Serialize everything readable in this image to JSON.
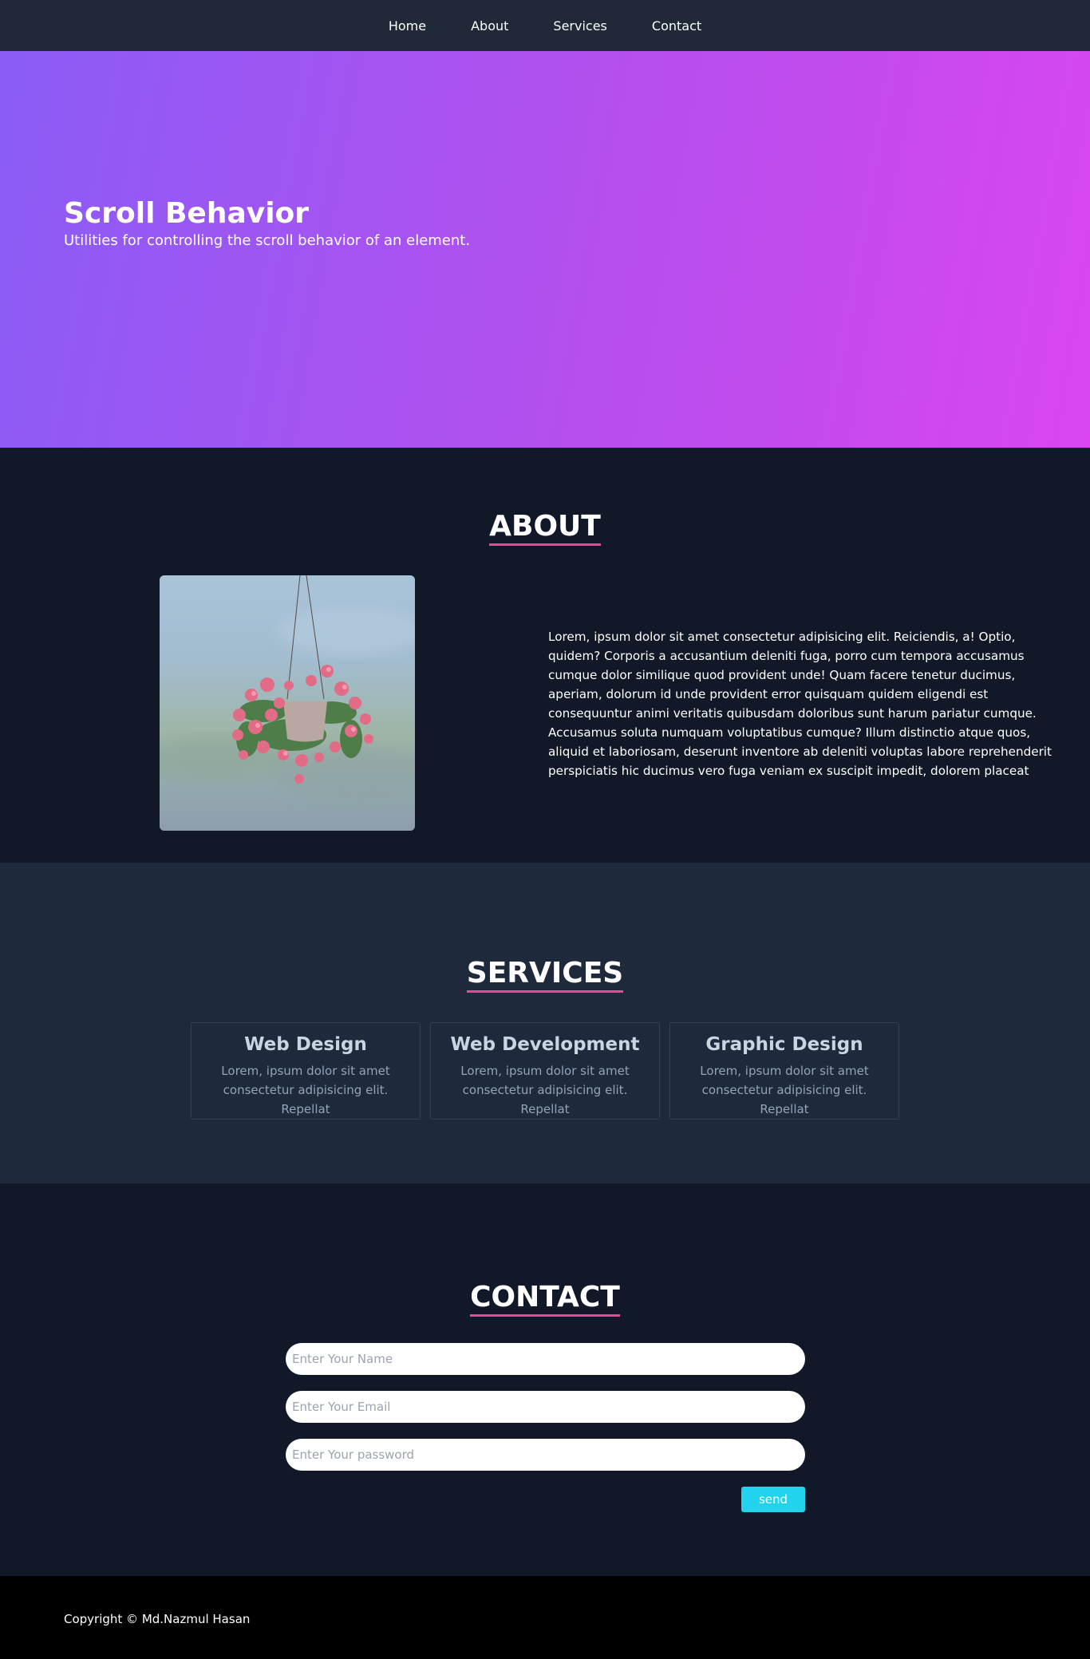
{
  "nav": {
    "items": [
      {
        "label": "Home"
      },
      {
        "label": "About"
      },
      {
        "label": "Services"
      },
      {
        "label": "Contact"
      }
    ]
  },
  "hero": {
    "title": "Scroll Behavior",
    "subtitle": "Utilities for controlling the scroll behavior of an element."
  },
  "about": {
    "heading": "ABOUT",
    "text": "Lorem, ipsum dolor sit amet consectetur adipisicing elit. Reiciendis, a! Optio, quidem? Corporis a accusantium deleniti fuga, porro cum tempora accusamus cumque dolor similique quod provident unde! Quam facere tenetur ducimus, aperiam, dolorum id unde provident error quisquam quidem eligendi est consequuntur animi veritatis quibusdam doloribus sunt harum pariatur cumque. Accusamus soluta numquam voluptatibus cumque? Illum distinctio atque quos, aliquid et laboriosam, deserunt inventore ab deleniti voluptas labore reprehenderit perspiciatis hic ducimus vero fuga veniam ex suscipit impedit, dolorem placeat"
  },
  "services": {
    "heading": "SERVICES",
    "cards": [
      {
        "title": "Web Design",
        "text": "Lorem, ipsum dolor sit amet consectetur adipisicing elit. Repellat"
      },
      {
        "title": "Web Development",
        "text": "Lorem, ipsum dolor sit amet consectetur adipisicing elit. Repellat"
      },
      {
        "title": "Graphic Design",
        "text": "Lorem, ipsum dolor sit amet consectetur adipisicing elit. Repellat"
      }
    ]
  },
  "contact": {
    "heading": "CONTACT",
    "name_placeholder": "Enter Your Name",
    "email_placeholder": "Enter Your Email",
    "password_placeholder": "Enter Your password",
    "send_label": "send"
  },
  "footer": {
    "copyright": "Copyright © Md.Nazmul Hasan"
  },
  "colors": {
    "nav_bg": "#1f2937",
    "hero_gradient_start": "#8b5cf6",
    "hero_gradient_end": "#d946ef",
    "heading_underline": "#ec4899",
    "send_button": "#22d3ee"
  }
}
